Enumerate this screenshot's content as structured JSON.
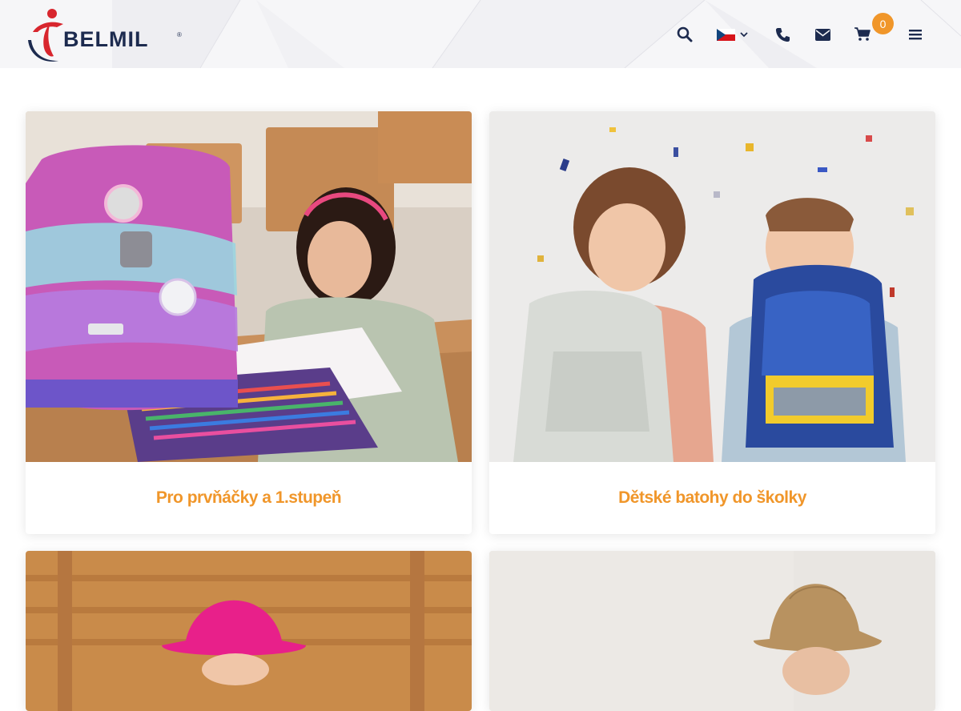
{
  "brand": {
    "name": "BELMIL",
    "registered": "®"
  },
  "header": {
    "language": "CZ",
    "cart_count": "0"
  },
  "icons": {
    "search": "search-icon",
    "flag": "czech-flag-icon",
    "chevron": "chevron-down-icon",
    "phone": "phone-icon",
    "mail": "envelope-icon",
    "cart": "cart-icon",
    "menu": "hamburger-menu-icon"
  },
  "colors": {
    "accent": "#f0962a",
    "logo_red": "#d8262e",
    "logo_navy": "#1d2b4f"
  },
  "categories": [
    {
      "label": "Pro prvňáčky a 1.stupeň"
    },
    {
      "label": "Dětské batohy do školky"
    },
    {
      "label": ""
    },
    {
      "label": ""
    }
  ]
}
